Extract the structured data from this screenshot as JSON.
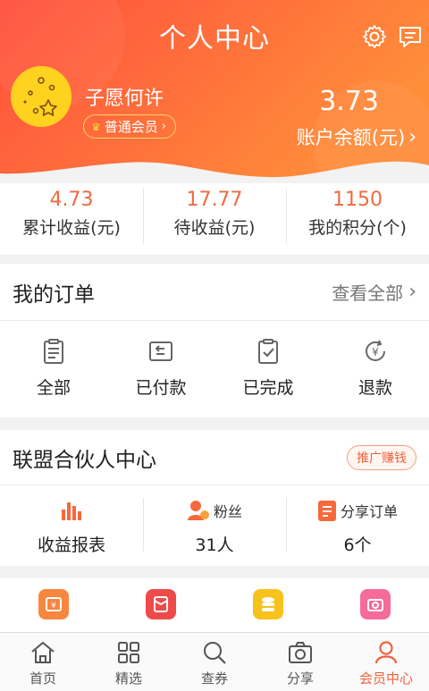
{
  "header": {
    "title": "个人中心",
    "username": "子愿何许",
    "member_level": "普通会员",
    "balance_value": "3.73",
    "balance_label": "账户余额(元)"
  },
  "stats": [
    {
      "value": "4.73",
      "label": "累计收益(元)"
    },
    {
      "value": "17.77",
      "label": "待收益(元)"
    },
    {
      "value": "1150",
      "label": "我的积分(个)"
    }
  ],
  "orders": {
    "title": "我的订单",
    "view_all": "查看全部",
    "items": [
      {
        "label": "全部",
        "icon": "clipboard-list-icon"
      },
      {
        "label": "已付款",
        "icon": "paid-icon"
      },
      {
        "label": "已完成",
        "icon": "completed-check-icon"
      },
      {
        "label": "退款",
        "icon": "refund-yen-icon"
      }
    ]
  },
  "partner": {
    "title": "联盟合伙人中心",
    "promo_button": "推广赚钱",
    "items": [
      {
        "top": "",
        "bottom": "收益报表",
        "icon": "bar-chart-icon"
      },
      {
        "top": "粉丝",
        "bottom": "31人",
        "icon": "fans-icon"
      },
      {
        "top": "分享订单",
        "bottom": "6个",
        "icon": "share-order-icon"
      }
    ]
  },
  "tools": [
    {
      "icon": "wallet-icon",
      "color": "#f7873f"
    },
    {
      "icon": "red-envelope-icon",
      "color": "#ef4a4a"
    },
    {
      "icon": "coins-icon",
      "color": "#f8c21c"
    },
    {
      "icon": "camera-icon",
      "color": "#f56b9a"
    }
  ],
  "tabbar": [
    {
      "label": "首页",
      "icon": "home-icon"
    },
    {
      "label": "精选",
      "icon": "grid-icon"
    },
    {
      "label": "查券",
      "icon": "search-icon"
    },
    {
      "label": "分享",
      "icon": "camera-icon"
    },
    {
      "label": "会员中心",
      "icon": "user-icon",
      "active": true
    }
  ],
  "colors": {
    "header_gradient_start": "#ff5a3c",
    "header_gradient_end": "#ff8a3a",
    "accent": "#f0623a"
  }
}
